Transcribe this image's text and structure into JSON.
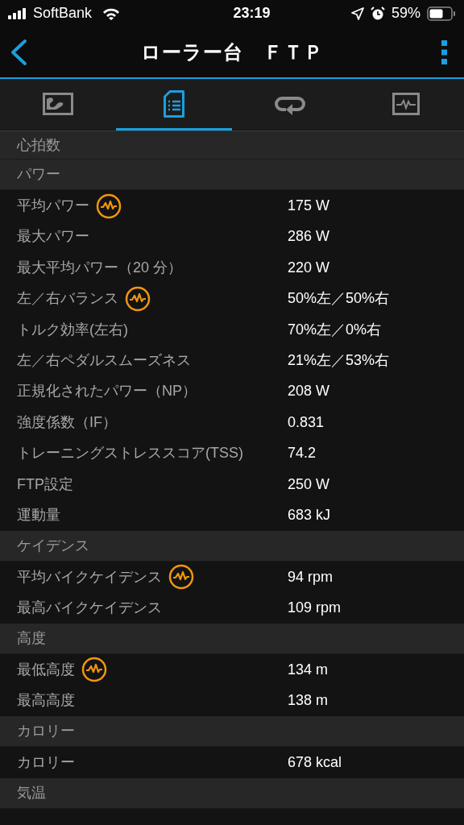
{
  "status_bar": {
    "carrier": "SoftBank",
    "time": "23:19",
    "battery": "59%"
  },
  "header": {
    "title": "ローラー台　ＦＴＰ"
  },
  "tabs": [
    {
      "selected": false
    },
    {
      "selected": true
    },
    {
      "selected": false
    },
    {
      "selected": false
    }
  ],
  "sections": [
    {
      "title": "心拍数"
    },
    {
      "title": "パワー",
      "rows": [
        {
          "label": "平均パワー",
          "value": "175 W",
          "chart": true
        },
        {
          "label": "最大パワー",
          "value": "286 W",
          "chart": false
        },
        {
          "label": "最大平均パワー（20 分）",
          "value": "220 W",
          "chart": false
        },
        {
          "label": "左／右バランス",
          "value": "50%左／50%右",
          "chart": true
        },
        {
          "label": "トルク効率(左右)",
          "value": "70%左／0%右",
          "chart": false
        },
        {
          "label": "左／右ペダルスムーズネス",
          "value": "21%左／53%右",
          "chart": false
        },
        {
          "label": "正規化されたパワー（NP）",
          "value": "208 W",
          "chart": false
        },
        {
          "label": "強度係数（IF）",
          "value": "0.831",
          "chart": false
        },
        {
          "label": "トレーニングストレススコア(TSS)",
          "value": "74.2",
          "chart": false
        },
        {
          "label": "FTP設定",
          "value": "250 W",
          "chart": false
        },
        {
          "label": "運動量",
          "value": "683 kJ",
          "chart": false
        }
      ]
    },
    {
      "title": "ケイデンス",
      "rows": [
        {
          "label": "平均バイクケイデンス",
          "value": "94 rpm",
          "chart": true
        },
        {
          "label": "最高バイクケイデンス",
          "value": "109 rpm",
          "chart": false
        }
      ]
    },
    {
      "title": "高度",
      "rows": [
        {
          "label": "最低高度",
          "value": "134 m",
          "chart": true
        },
        {
          "label": "最高高度",
          "value": "138 m",
          "chart": false
        }
      ]
    },
    {
      "title": "カロリー",
      "rows": [
        {
          "label": "カロリー",
          "value": "678 kcal",
          "chart": false
        }
      ]
    },
    {
      "title": "気温"
    }
  ]
}
